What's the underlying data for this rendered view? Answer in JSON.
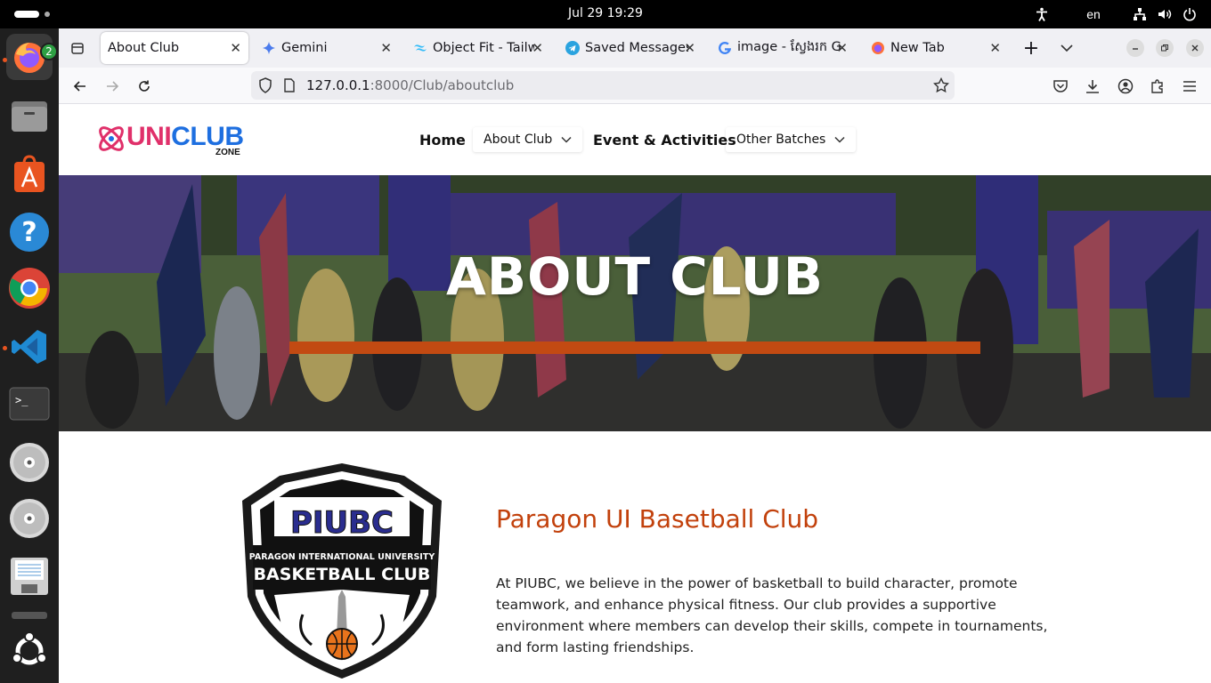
{
  "topbar": {
    "clock": "Jul 29  19:29",
    "language": "en"
  },
  "dock": {
    "firefox_badge": "2",
    "items": [
      "firefox-icon",
      "files-icon",
      "app-center-icon",
      "help-icon",
      "chrome-icon",
      "vscode-icon",
      "terminal-icon",
      "disc-icon",
      "disc-icon",
      "save-disk-icon",
      "ubuntu-icon"
    ]
  },
  "browser": {
    "tabs": [
      {
        "title": "About Club",
        "icon": "page-icon",
        "active": true
      },
      {
        "title": "Gemini",
        "icon": "gemini-icon"
      },
      {
        "title": "Object Fit - Tailwi",
        "icon": "tailwind-icon"
      },
      {
        "title": "Saved Messages",
        "icon": "telegram-icon"
      },
      {
        "title": "image - ស្វែងរក Go",
        "icon": "google-icon"
      },
      {
        "title": "New Tab",
        "icon": "firefox-icon"
      }
    ],
    "url_host": "127.0.0.1",
    "url_path": ":8000/Club/aboutclub"
  },
  "site": {
    "logo": {
      "part1": "UNI",
      "part2": "CLUB",
      "sub": "ZONE"
    },
    "nav": {
      "home": "Home",
      "about": "About Club",
      "events": "Event & Activities",
      "other": "Other Batches"
    },
    "hero": {
      "title": "ABOUT CLUB",
      "accent": "#c24a12"
    },
    "about": {
      "emblem_top": "PIUBC",
      "emblem_sub": "PARAGON INTERNATIONAL UNIVERSITY",
      "emblem_main": "BASKETBALL CLUB",
      "heading": "Paragon UI Basetball Club",
      "paragraph": "At PIUBC, we believe in the power of basketball to build character, promote teamwork, and enhance physical fitness. Our club provides a supportive environment where members can develop their skills, compete in tournaments, and form lasting friendships."
    }
  },
  "colors": {
    "accent": "#c2410c",
    "brand_pink": "#e0306a",
    "brand_blue": "#1e6fe0"
  }
}
